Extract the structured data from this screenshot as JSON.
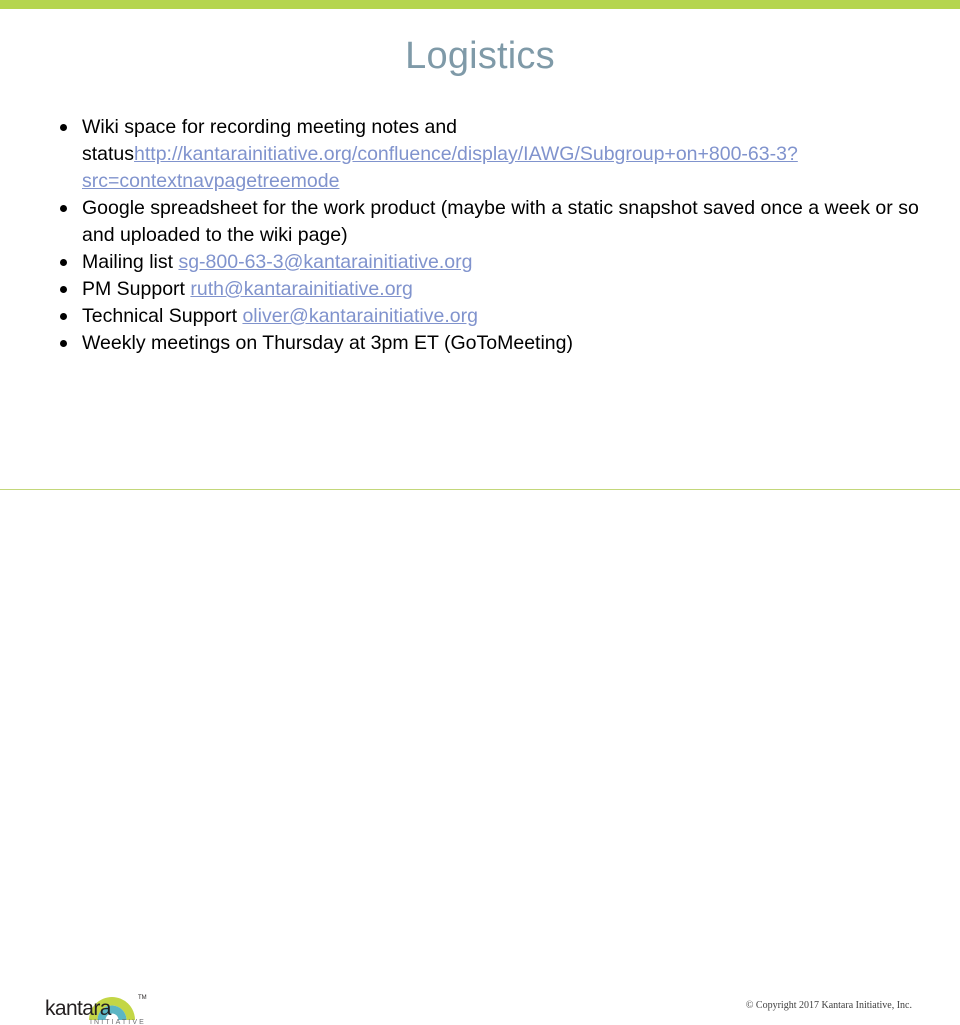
{
  "slide": {
    "title": "Logistics",
    "accent_bar_color": "#b5d54e",
    "title_color": "#7f9aa8",
    "link_color": "#8093cd",
    "background_color": "#ffffff"
  },
  "bullets": [
    {
      "id": "wiki-space",
      "segments": [
        {
          "type": "text",
          "value": "Wiki space for recording meeting notes and status"
        },
        {
          "type": "link",
          "value": "http://kantarainitiative.org/confluence/display/IAWG/Subgroup+on+800-63-3?src=contextnavpagetreemode"
        }
      ],
      "gap_before": false
    },
    {
      "id": "google-spreadsheet",
      "segments": [
        {
          "type": "text",
          "value": "Google spreadsheet for the work product (maybe with a static snapshot saved once a week or so and uploaded to the wiki page)"
        }
      ],
      "gap_before": false
    },
    {
      "id": "mailing-list",
      "segments": [
        {
          "type": "text",
          "value": "Mailing list "
        },
        {
          "type": "link",
          "value": "sg-800-63-3@kantarainitiative.org"
        }
      ],
      "gap_before": true
    },
    {
      "id": "pm-support",
      "segments": [
        {
          "type": "text",
          "value": "PM Support "
        },
        {
          "type": "link",
          "value": "ruth@kantarainitiative.org"
        }
      ],
      "gap_before": true
    },
    {
      "id": "technical-support",
      "segments": [
        {
          "type": "text",
          "value": "Technical Support "
        },
        {
          "type": "link",
          "value": "oliver@kantarainitiative.org"
        }
      ],
      "gap_before": false
    },
    {
      "id": "weekly-meetings",
      "segments": [
        {
          "type": "text",
          "value": "Weekly meetings on Thursday at 3pm ET (GoToMeeting)"
        }
      ],
      "gap_before": true
    }
  ],
  "footer": {
    "logo": {
      "wordmark": "kantara",
      "subtitle": "INITIATIVE",
      "trademark": "™",
      "arch_outer_color": "#c3d646",
      "arch_inner_color": "#5bb6c4",
      "wordmark_color": "#231f20",
      "subtitle_color": "#6d6e71"
    },
    "copyright": "© Copyright 2017 Kantara Initiative, Inc."
  }
}
